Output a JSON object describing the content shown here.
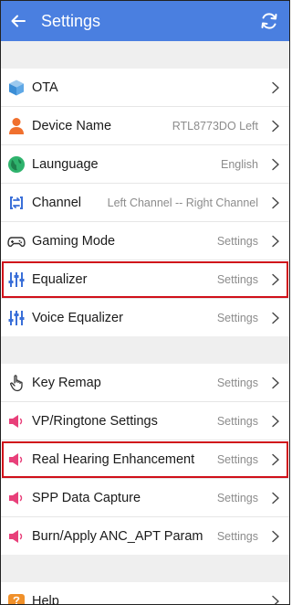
{
  "header": {
    "title": "Settings"
  },
  "groups": [
    [
      {
        "name": "ota",
        "icon": "cube-icon",
        "label": "OTA",
        "value": ""
      },
      {
        "name": "device-name",
        "icon": "person-icon",
        "label": "Device Name",
        "value": "RTL8773DO Left"
      },
      {
        "name": "language",
        "icon": "globe-icon",
        "label": "Launguage",
        "value": "English"
      },
      {
        "name": "channel",
        "icon": "swap-icon",
        "label": "Channel",
        "value": "Left Channel -- Right Channel"
      },
      {
        "name": "gaming-mode",
        "icon": "gamepad-icon",
        "label": "Gaming Mode",
        "value": "Settings"
      },
      {
        "name": "equalizer",
        "icon": "equalizer-icon",
        "label": "Equalizer",
        "value": "Settings",
        "highlight": true
      },
      {
        "name": "voice-equalizer",
        "icon": "equalizer-icon",
        "label": "Voice Equalizer",
        "value": "Settings"
      }
    ],
    [
      {
        "name": "key-remap",
        "icon": "hand-pointer-icon",
        "label": "Key Remap",
        "value": "Settings"
      },
      {
        "name": "vp-ringtone-settings",
        "icon": "speaker-icon",
        "label": "VP/Ringtone Settings",
        "value": "Settings"
      },
      {
        "name": "real-hearing-enhancement",
        "icon": "speaker-icon",
        "label": "Real Hearing Enhancement",
        "value": "Settings",
        "highlight": true
      },
      {
        "name": "spp-data-capture",
        "icon": "speaker-icon",
        "label": "SPP Data Capture",
        "value": "Settings"
      },
      {
        "name": "burn-apply-anc-apt-param",
        "icon": "speaker-icon",
        "label": "Burn/Apply ANC_APT Param",
        "value": "Settings"
      }
    ],
    [
      {
        "name": "help",
        "icon": "help-icon",
        "label": "Help",
        "value": ""
      }
    ]
  ],
  "colors": {
    "header": "#4a7fe0",
    "highlight": "#d0101a",
    "speaker": "#e8407a",
    "blue": "#3a6fd8"
  }
}
